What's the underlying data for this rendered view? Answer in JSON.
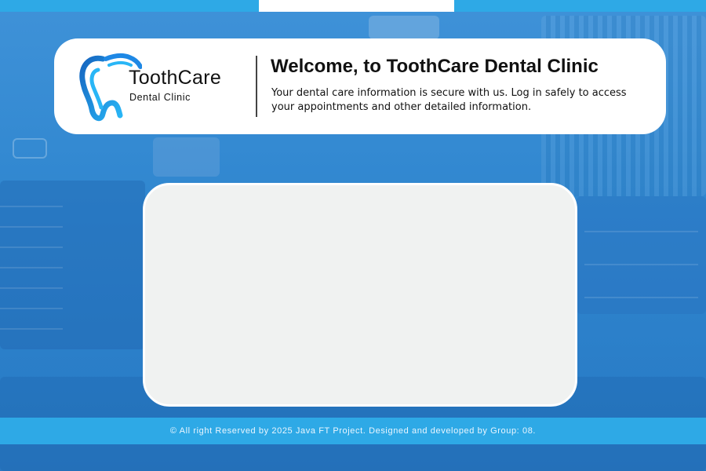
{
  "brand": {
    "name": "ToothCare",
    "subtitle": "Dental Clinic",
    "primary_color": "#1e88e5",
    "accent_color": "#2ea9e6"
  },
  "header": {
    "title": "Welcome, to ToothCare Dental Clinic",
    "description": "Your dental care information is secure with us. Log in safely to access your appointments and other detailed information."
  },
  "footer": {
    "text": "© All right Reserved by 2025 Java FT Project. Designed and developed by Group: 08."
  },
  "icons": {
    "logo": "tooth-logo-icon"
  }
}
